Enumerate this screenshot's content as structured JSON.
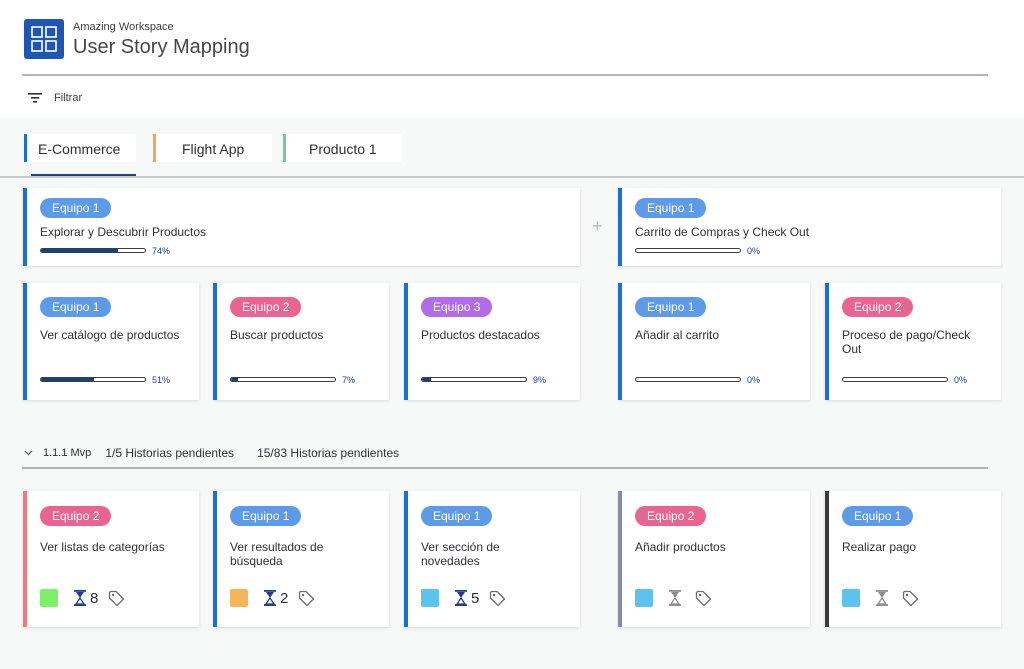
{
  "header": {
    "workspace": "Amazing Workspace",
    "title": "User Story Mapping",
    "logo_icon": "grid-icon"
  },
  "toolbar": {
    "filter_label": "Filtrar",
    "filter_icon": "filter-icon"
  },
  "tabs": [
    {
      "label": "E-Commerce",
      "color": "#1a6fd6",
      "active": true
    },
    {
      "label": "Flight App",
      "color": "#f0a95c"
    },
    {
      "label": "Producto 1",
      "color": "#6fcf97"
    }
  ],
  "epics": [
    {
      "team": "Equipo 1",
      "team_color": "#5d9be8",
      "stripe_color": "#1a6fd6",
      "title": "Explorar y Descubrir Productos",
      "progress": 0.74,
      "progress_label": "74%"
    },
    {
      "team": "Equipo 1",
      "team_color": "#5d9be8",
      "stripe_color": "#1a6fd6",
      "title": "Carrito de Compras y Check Out",
      "progress": 0.0,
      "progress_label": "0%"
    }
  ],
  "features": [
    {
      "team": "Equipo 1",
      "team_color": "#5d9be8",
      "stripe_color": "#1a6fd6",
      "title": "Ver catálogo de productos",
      "progress": 0.51,
      "progress_label": "51%"
    },
    {
      "team": "Equipo 2",
      "team_color": "#e8658f",
      "stripe_color": "#1a6fd6",
      "title": "Buscar productos",
      "progress": 0.07,
      "progress_label": "7%"
    },
    {
      "team": "Equipo 3",
      "team_color": "#b36be8",
      "stripe_color": "#1a6fd6",
      "title": "Productos destacados",
      "progress": 0.09,
      "progress_label": "9%"
    },
    {
      "team": "Equipo 1",
      "team_color": "#5d9be8",
      "stripe_color": "#1a6fd6",
      "title": "Añadir al carrito",
      "progress": 0.0,
      "progress_label": "0%"
    },
    {
      "team": "Equipo 2",
      "team_color": "#e8658f",
      "stripe_color": "#1a6fd6",
      "title": "Proceso de pago/Check Out",
      "progress": 0.0,
      "progress_label": "0%"
    }
  ],
  "release": {
    "name": "1.1.1 Mvp",
    "pending_release": "1/5 Historias pendientes",
    "pending_total": "15/83 Historias pendientes"
  },
  "stories": [
    {
      "team": "Equipo 2",
      "team_color": "#e8658f",
      "stripe_color": "#f07a7a",
      "title": "Ver listas de categorías",
      "swatch": "#7cf06a",
      "estimate": "8",
      "hourglass_color": "#1f3e8f"
    },
    {
      "team": "Equipo 1",
      "team_color": "#5d9be8",
      "stripe_color": "#1a6fd6",
      "title": "Ver resultados de búsqueda",
      "swatch": "#f5b55a",
      "estimate": "2",
      "hourglass_color": "#1f3e8f"
    },
    {
      "team": "Equipo 1",
      "team_color": "#5d9be8",
      "stripe_color": "#1a6fd6",
      "title": "Ver sección de novedades",
      "swatch": "#5cc3ef",
      "estimate": "5",
      "hourglass_color": "#1f3e8f"
    },
    {
      "team": "Equipo 2",
      "team_color": "#e8658f",
      "stripe_color": "#8a8aa8",
      "title": "Añadir productos",
      "swatch": "#5cc3ef",
      "estimate": "",
      "hourglass_color": "#8c8e92"
    },
    {
      "team": "Equipo 1",
      "team_color": "#5d9be8",
      "stripe_color": "#3a3a3a",
      "title": "Realizar pago",
      "swatch": "#5cc3ef",
      "estimate": "",
      "hourglass_color": "#8c8e92"
    }
  ]
}
